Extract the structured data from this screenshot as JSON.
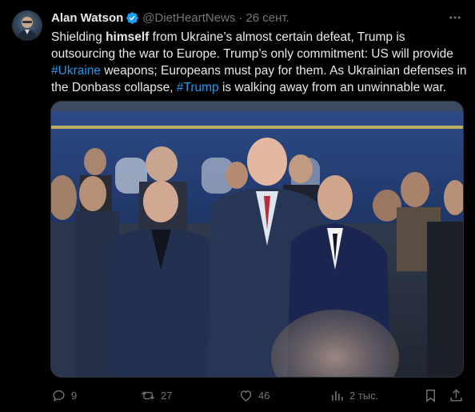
{
  "tweet": {
    "author_name": "Alan Watson",
    "handle": "@DietHeartNews",
    "separator": "·",
    "date": "26 сент.",
    "text": {
      "p1": "Shielding ",
      "p2": "himself",
      "p3": " from Ukraine’s almost certain defeat, Trump is outsourcing the war to Europe. Trump’s only commitment: US will provide ",
      "p4": "#Ukraine",
      "p5": " weapons; Europeans must pay for them. As Ukrainian defenses in the Donbass collapse, ",
      "p6": "#Trump",
      "p7": " is walking away from an unwinnable war."
    }
  },
  "actions": {
    "replies": "9",
    "reposts": "27",
    "likes": "46",
    "views": "2 тыс."
  },
  "icons": {
    "verified": "verified-badge-icon",
    "more": "more-dots-icon",
    "reply": "reply-icon",
    "repost": "repost-icon",
    "like": "heart-icon",
    "views": "views-chart-icon",
    "bookmark": "bookmark-icon",
    "share": "share-icon"
  },
  "colors": {
    "background": "#000000",
    "text": "#e7e9ea",
    "secondary": "#71767b",
    "accent": "#1d9bf0"
  }
}
